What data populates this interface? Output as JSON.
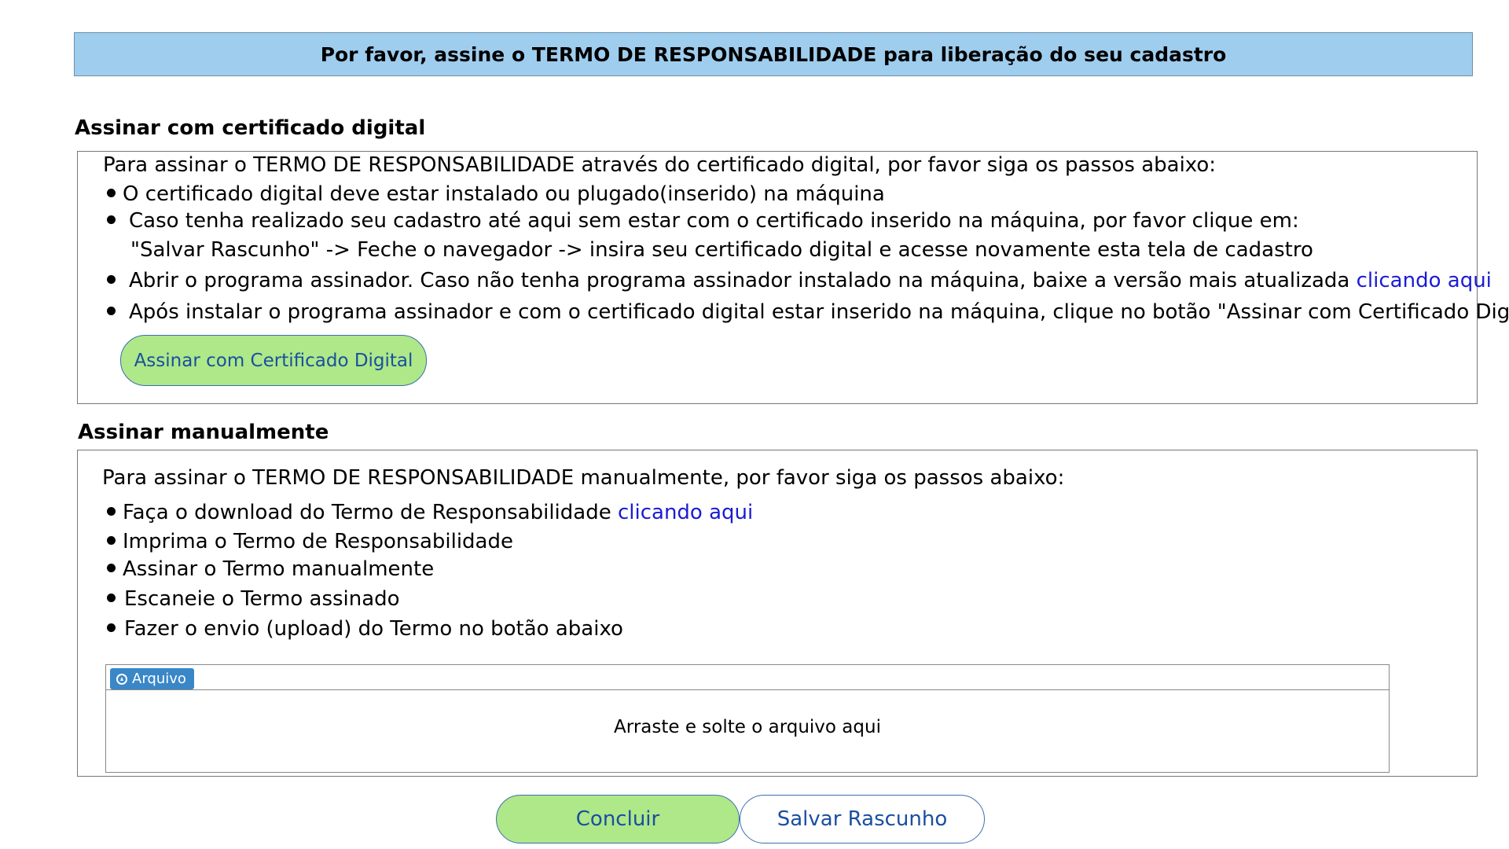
{
  "banner": {
    "text": "Por favor, assine o TERMO DE RESPONSABILIDADE para liberação do seu cadastro"
  },
  "certificate_section": {
    "title": "Assinar com certificado digital",
    "intro": "Para assinar o TERMO DE RESPONSABILIDADE através do certificado digital, por favor siga os passos abaixo:",
    "steps": [
      "O certificado digital deve estar instalado ou plugado(inserido) na máquina",
      "Caso tenha realizado seu cadastro até aqui sem estar com o certificado inserido na máquina, por favor clique em:",
      "\"Salvar Rascunho\" -> Feche o navegador -> insira seu certificado digital e acesse novamente esta tela de cadastro",
      "Abrir o programa assinador. Caso não tenha programa assinador instalado na máquina, baixe a versão mais atualizada",
      "Após instalar o programa assinador e com o certificado digital estar inserido na máquina, clique no botão \"Assinar com Certificado Digital\""
    ],
    "download_link": "clicando aqui",
    "sign_button": "Assinar com Certificado Digital"
  },
  "manual_section": {
    "title": "Assinar manualmente",
    "intro": "Para assinar o TERMO DE RESPONSABILIDADE manualmente, por favor siga os passos abaixo:",
    "steps": [
      "Faça o download do Termo de Responsabilidade",
      "Imprima o Termo de Responsabilidade",
      "Assinar o Termo manualmente",
      "Escaneie o Termo assinado",
      "Fazer o envio (upload) do Termo no botão abaixo"
    ],
    "download_link": "clicando aqui",
    "upload": {
      "button_label": "Arquivo",
      "button_icon": "upload-circle-icon",
      "drop_text": "Arraste e solte o arquivo aqui"
    }
  },
  "actions": {
    "conclude": "Concluir",
    "save_draft": "Salvar Rascunho"
  },
  "colors": {
    "banner_bg": "#9fcdee",
    "primary_button_bg": "#aee888",
    "button_text": "#1a4fa0",
    "link": "#1b1bd6",
    "upload_button_bg": "#3a87c8"
  }
}
